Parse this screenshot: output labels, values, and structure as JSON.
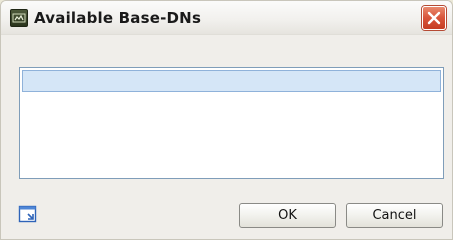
{
  "dialog": {
    "title": "Available Base-DNs",
    "app_icon": "app-icon",
    "close_icon": "close-icon"
  },
  "list": {
    "items": [
      ""
    ],
    "selected_index": 0
  },
  "footer": {
    "corner_icon": "window-resize-icon",
    "ok_label": "OK",
    "cancel_label": "Cancel"
  },
  "colors": {
    "close_button": "#d8543a",
    "selection": "#d5e6f7",
    "list_border": "#7f9db9"
  }
}
